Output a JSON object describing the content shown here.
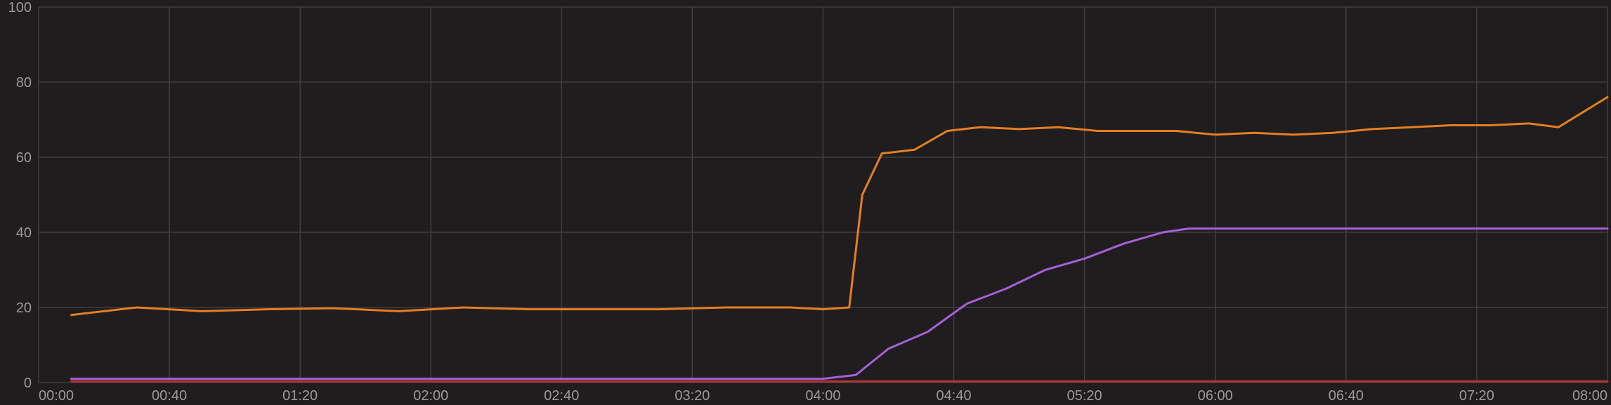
{
  "chart_data": {
    "type": "line",
    "title": "",
    "xlabel": "",
    "ylabel": "",
    "ylim": [
      0,
      100
    ],
    "xlim": [
      0,
      480
    ],
    "y_ticks": [
      0,
      20,
      40,
      60,
      80,
      100
    ],
    "x_ticks": [
      {
        "minutes": 0,
        "label": "00:00"
      },
      {
        "minutes": 40,
        "label": "00:40"
      },
      {
        "minutes": 80,
        "label": "01:20"
      },
      {
        "minutes": 120,
        "label": "02:00"
      },
      {
        "minutes": 160,
        "label": "02:40"
      },
      {
        "minutes": 200,
        "label": "03:20"
      },
      {
        "minutes": 240,
        "label": "04:00"
      },
      {
        "minutes": 280,
        "label": "04:40"
      },
      {
        "minutes": 320,
        "label": "05:20"
      },
      {
        "minutes": 360,
        "label": "06:00"
      },
      {
        "minutes": 400,
        "label": "06:40"
      },
      {
        "minutes": 440,
        "label": "07:20"
      },
      {
        "minutes": 480,
        "label": "08:00"
      }
    ],
    "series": [
      {
        "name": "orange",
        "color": "#e67e22",
        "points": [
          {
            "x": 10,
            "y": 18
          },
          {
            "x": 30,
            "y": 20
          },
          {
            "x": 50,
            "y": 19
          },
          {
            "x": 70,
            "y": 19.5
          },
          {
            "x": 90,
            "y": 19.8
          },
          {
            "x": 110,
            "y": 19
          },
          {
            "x": 130,
            "y": 20
          },
          {
            "x": 150,
            "y": 19.5
          },
          {
            "x": 170,
            "y": 19.5
          },
          {
            "x": 190,
            "y": 19.5
          },
          {
            "x": 210,
            "y": 20
          },
          {
            "x": 230,
            "y": 20
          },
          {
            "x": 240,
            "y": 19.5
          },
          {
            "x": 248,
            "y": 20
          },
          {
            "x": 252,
            "y": 50
          },
          {
            "x": 258,
            "y": 61
          },
          {
            "x": 268,
            "y": 62
          },
          {
            "x": 278,
            "y": 67
          },
          {
            "x": 288,
            "y": 68
          },
          {
            "x": 300,
            "y": 67.5
          },
          {
            "x": 312,
            "y": 68
          },
          {
            "x": 324,
            "y": 67
          },
          {
            "x": 336,
            "y": 67
          },
          {
            "x": 348,
            "y": 67
          },
          {
            "x": 360,
            "y": 66
          },
          {
            "x": 372,
            "y": 66.5
          },
          {
            "x": 384,
            "y": 66
          },
          {
            "x": 396,
            "y": 66.5
          },
          {
            "x": 408,
            "y": 67.5
          },
          {
            "x": 420,
            "y": 68
          },
          {
            "x": 432,
            "y": 68.5
          },
          {
            "x": 444,
            "y": 68.5
          },
          {
            "x": 456,
            "y": 69
          },
          {
            "x": 465,
            "y": 68
          },
          {
            "x": 480,
            "y": 76
          }
        ]
      },
      {
        "name": "purple",
        "color": "#a660d8",
        "points": [
          {
            "x": 10,
            "y": 1
          },
          {
            "x": 240,
            "y": 1
          },
          {
            "x": 250,
            "y": 2
          },
          {
            "x": 260,
            "y": 9
          },
          {
            "x": 272,
            "y": 13.5
          },
          {
            "x": 284,
            "y": 21
          },
          {
            "x": 296,
            "y": 25
          },
          {
            "x": 308,
            "y": 30
          },
          {
            "x": 320,
            "y": 33
          },
          {
            "x": 332,
            "y": 37
          },
          {
            "x": 344,
            "y": 40
          },
          {
            "x": 352,
            "y": 41
          },
          {
            "x": 480,
            "y": 41
          }
        ]
      },
      {
        "name": "red",
        "color": "#b83333",
        "points": [
          {
            "x": 10,
            "y": 0.3
          },
          {
            "x": 480,
            "y": 0.3
          }
        ]
      }
    ]
  },
  "colors": {
    "background": "#1f1d1d",
    "grid": "#413f3f",
    "label": "#9b9a9a"
  }
}
